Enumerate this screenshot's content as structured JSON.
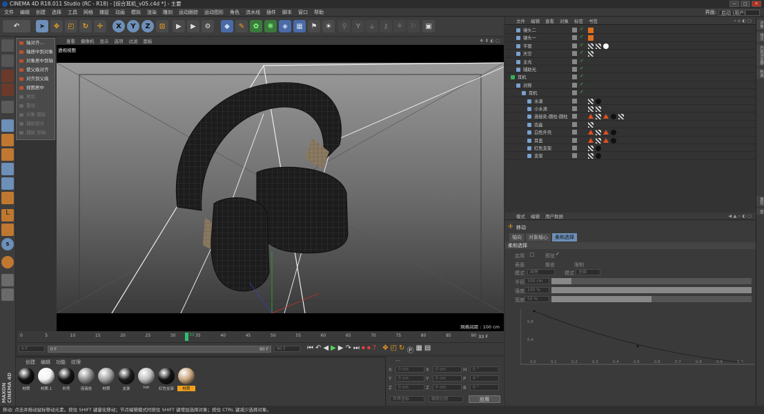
{
  "app": {
    "title": "CINEMA 4D R18.011 Studio (RC - R18) - [综合耳机_v05.c4d *] - 主要",
    "window_controls": [
      "—",
      "□",
      "✕"
    ]
  },
  "menu": [
    "文件",
    "编辑",
    "创建",
    "选择",
    "工具",
    "网格",
    "捕捉",
    "动画",
    "模拟",
    "渲染",
    "雕刻",
    "运动跟踪",
    "运动图形",
    "角色",
    "流水线",
    "插件",
    "脚本",
    "窗口",
    "帮助"
  ],
  "layout": {
    "label": "界面:",
    "value": "启动 (用户)"
  },
  "toolbar": {
    "axes": [
      "X",
      "Y",
      "Z"
    ]
  },
  "popup_menu": {
    "items": [
      {
        "label": "轴对齐...",
        "enabled": true
      },
      {
        "label": "轴居中到对象",
        "enabled": true
      },
      {
        "label": "对象居中到轴",
        "enabled": true
      },
      {
        "label": "使父级对齐",
        "enabled": true
      },
      {
        "label": "对齐到父级",
        "enabled": true
      },
      {
        "label": "视图居中",
        "enabled": true
      },
      {
        "label": "居到",
        "enabled": false
      },
      {
        "label": "重设",
        "enabled": false
      },
      {
        "label": "对象 捕捉",
        "enabled": false
      },
      {
        "label": "捕捉到点",
        "enabled": false
      },
      {
        "label": "捕捉 到轴",
        "enabled": false
      }
    ]
  },
  "viewport": {
    "menu": [
      "查看",
      "摄像机",
      "显示",
      "选项",
      "过滤",
      "面板"
    ],
    "name": "透视视图",
    "grid_info": "网格间距 : 100 cm"
  },
  "timeline": {
    "ticks": [
      "0",
      "5",
      "10",
      "15",
      "20",
      "25",
      "30",
      "35",
      "40",
      "45",
      "50",
      "55",
      "60",
      "65",
      "70",
      "75",
      "80",
      "85",
      "90"
    ],
    "current_frame": "33",
    "frame_readout": "33 F",
    "start_field": "0 F",
    "range_start": "0 F",
    "range_end": "90 F",
    "end_field": "90 F"
  },
  "material_panel": {
    "menu": [
      "创建",
      "编辑",
      "功能",
      "纹理"
    ],
    "materials": [
      {
        "name": "材质",
        "color": "#111111"
      },
      {
        "name": "材质.1",
        "color": "#f2f2f2"
      },
      {
        "name": "外壳",
        "color": "#151515"
      },
      {
        "name": "连接处",
        "color": "#8a8a8a"
      },
      {
        "name": "材质",
        "color": "#a0a0a0"
      },
      {
        "name": "支架",
        "color": "#1c1c1c"
      },
      {
        "name": "hdr",
        "color": "#bcbcbc"
      },
      {
        "name": "红色支架",
        "color": "#141414"
      },
      {
        "name": "材质",
        "color": "#c8a57e"
      }
    ],
    "brand": "MAXON CINEMA 4D"
  },
  "coordinates": {
    "header": "---",
    "rows": [
      {
        "a": "X",
        "av": "0 cm",
        "b": "X",
        "bv": "0 cm",
        "c": "H",
        "cv": "0 °"
      },
      {
        "a": "Y",
        "av": "0 cm",
        "b": "Y",
        "bv": "0 cm",
        "c": "P",
        "cv": "0 °"
      },
      {
        "a": "Z",
        "av": "0 cm",
        "b": "Z",
        "bv": "0 cm",
        "c": "B",
        "cv": "0 °"
      }
    ],
    "mode1": "世界坐标",
    "mode2": "缩放比例",
    "apply": "应用"
  },
  "object_manager": {
    "menu": [
      "文件",
      "编辑",
      "查看",
      "对象",
      "标签",
      "书签"
    ],
    "objects": [
      {
        "name": "镜头二",
        "indent": 1,
        "tags": [
          "cam"
        ]
      },
      {
        "name": "镜头一",
        "indent": 1,
        "tags": [
          "cam"
        ]
      },
      {
        "name": "平面",
        "indent": 1,
        "tags": [
          "mat",
          "mat",
          "white"
        ]
      },
      {
        "name": "天空",
        "indent": 1,
        "tags": [
          "mat"
        ]
      },
      {
        "name": "主光",
        "indent": 1,
        "tags": []
      },
      {
        "name": "辅助光",
        "indent": 1,
        "tags": []
      },
      {
        "name": "耳机",
        "indent": 0,
        "tags": []
      },
      {
        "name": "对称",
        "indent": 1,
        "tags": []
      },
      {
        "name": "耳机",
        "indent": 2,
        "tags": []
      },
      {
        "name": "水滴",
        "indent": 3,
        "tags": [
          "mat",
          "black"
        ]
      },
      {
        "name": "小水滴",
        "indent": 3,
        "tags": [
          "mat",
          "mat"
        ]
      },
      {
        "name": "连接处-圆柱-圆柱",
        "indent": 3,
        "tags": [
          "warn",
          "mat",
          "warn",
          "black",
          "mat"
        ]
      },
      {
        "name": "齿盒",
        "indent": 3,
        "tags": [
          "mat"
        ]
      },
      {
        "name": "白色外壳",
        "indent": 3,
        "tags": [
          "warn",
          "mat",
          "warn",
          "black"
        ]
      },
      {
        "name": "耳盖",
        "indent": 3,
        "tags": [
          "warn",
          "mat",
          "warn",
          "black"
        ]
      },
      {
        "name": "红色支架",
        "indent": 3,
        "tags": [
          "mat",
          "black"
        ]
      },
      {
        "name": "支架",
        "indent": 3,
        "tags": [
          "mat",
          "black"
        ]
      }
    ]
  },
  "attribute_manager": {
    "menu": [
      "模式",
      "编辑",
      "用户数据"
    ],
    "title": "移动",
    "tabs": [
      "轴向",
      "对象轴心",
      "柔和选择"
    ],
    "section": "柔和选择",
    "fields": {
      "enable": "启用",
      "preview": "预览",
      "surface": "表面",
      "rubber": "橡皮",
      "restrict": "限制",
      "mode_label": "模式",
      "mode_value": "线性",
      "type_label": "模式",
      "type_value": "全部",
      "radius_label": "半径",
      "radius_value": "100 cm",
      "strength_label": "强度",
      "strength_value": "100 %",
      "width_label": "宽度",
      "width_value": "50 %"
    },
    "graph": {
      "x_ticks": [
        "0.0",
        "0.1",
        "0.2",
        "0.3",
        "0.4",
        "0.5",
        "0.6",
        "0.7",
        "0.8",
        "0.9",
        "1.0"
      ],
      "y_ticks": [
        "0.8",
        "0.4"
      ]
    }
  },
  "side_tabs": [
    "对象",
    "场次",
    "内容浏览器",
    "构造",
    "属性",
    "层"
  ],
  "status": "移动: 点击并拖动鼠标移动元素。按住 SHIFT 键量化移动；节点编辑模式时按住 SHIFT 键增加选择对象；按住 CTRL 键减少选择对象。"
}
